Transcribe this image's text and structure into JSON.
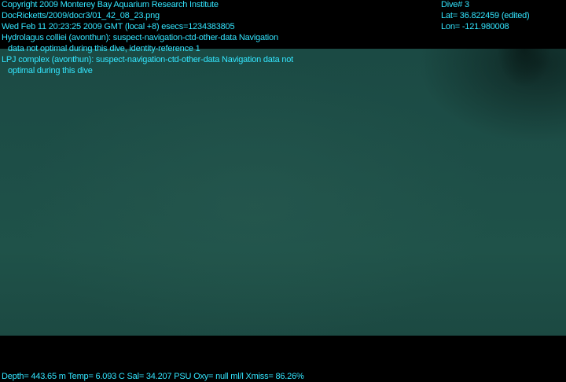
{
  "header": {
    "copyright": "Copyright 2009 Monterey Bay Aquarium Research Institute",
    "file_path": "DocRicketts/2009/docr3/01_42_08_23.png",
    "timestamp": "Wed Feb 11 20:23:25 2009 GMT (local +8)  esecs=1234383805",
    "annotation1_line1": "Hydrolagus colliei (avonthun): suspect-navigation-ctd-other-data Navigation",
    "annotation1_line2": "data not optimal during this dive, identity-reference 1",
    "annotation2_line1": "LPJ complex (avonthun): suspect-navigation-ctd-other-data Navigation data not",
    "annotation2_line2": "optimal during this dive"
  },
  "position": {
    "dive": "Dive# 3",
    "lat": "Lat= 36.822459 (edited)",
    "lon": "Lon= -121.980008"
  },
  "footer": {
    "sensors": "Depth= 443.65 m  Temp= 6.093 C  Sal= 34.207 PSU  Oxy= null ml/l  Xmiss= 86.26%"
  },
  "colors": {
    "overlay_text": "#33e6ff",
    "water": "#1d4e47"
  }
}
